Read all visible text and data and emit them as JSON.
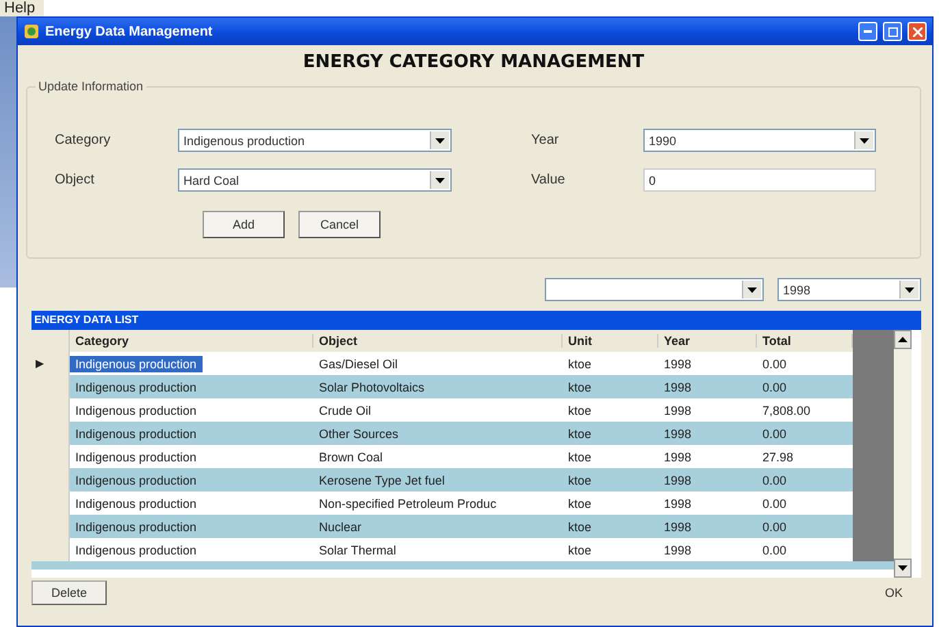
{
  "menu": {
    "items": [
      "Help"
    ]
  },
  "window": {
    "title": "Energy Data Management"
  },
  "heading": "ENERGY CATEGORY MANAGEMENT",
  "update_group": {
    "title": "Update Information",
    "fields": [
      {
        "label": "Category",
        "kind": "dropdown",
        "value": "Indigenous production"
      },
      {
        "label": "Year",
        "kind": "dropdown",
        "value": "1990"
      },
      {
        "label": "Object",
        "kind": "dropdown",
        "value": "Hard Coal"
      },
      {
        "label": "Value",
        "kind": "text",
        "value": "0"
      }
    ],
    "buttons": [
      "Add",
      "Cancel"
    ]
  },
  "filters": [
    {
      "kind": "dropdown"
    },
    {
      "kind": "dropdown",
      "value": "1998"
    }
  ],
  "grid": {
    "title": "ENERGY DATA LIST",
    "current_row_marker": "▶",
    "columns": [
      "Category",
      "Object",
      "Unit",
      "Year",
      "Total"
    ],
    "rows": [
      {
        "cells": [
          "Indigenous production",
          "Gas/Diesel Oil",
          "ktoe",
          "1998",
          "0.00"
        ],
        "selected": true
      },
      {
        "cells": [
          "Indigenous production",
          "Solar Photovoltaics",
          "ktoe",
          "1998",
          "0.00"
        ],
        "selected": false
      },
      {
        "cells": [
          "Indigenous production",
          "Crude Oil",
          "ktoe",
          "1998",
          "7,808.00"
        ],
        "selected": false
      },
      {
        "cells": [
          "Indigenous production",
          "Other Sources",
          "ktoe",
          "1998",
          "0.00"
        ],
        "selected": false
      },
      {
        "cells": [
          "Indigenous production",
          "Brown Coal",
          "ktoe",
          "1998",
          "27.98"
        ],
        "selected": false
      },
      {
        "cells": [
          "Indigenous production",
          "Kerosene Type Jet fuel",
          "ktoe",
          "1998",
          "0.00"
        ],
        "selected": false
      },
      {
        "cells": [
          "Indigenous production",
          "Non-specified Petroleum Produc",
          "ktoe",
          "1998",
          "0.00"
        ],
        "selected": false
      },
      {
        "cells": [
          "Indigenous production",
          "Nuclear",
          "ktoe",
          "1998",
          "0.00"
        ],
        "selected": false
      },
      {
        "cells": [
          "Indigenous production",
          "Solar Thermal",
          "ktoe",
          "1998",
          "0.00"
        ],
        "selected": false
      }
    ]
  },
  "footer_buttons": [
    "Delete",
    "OK"
  ]
}
